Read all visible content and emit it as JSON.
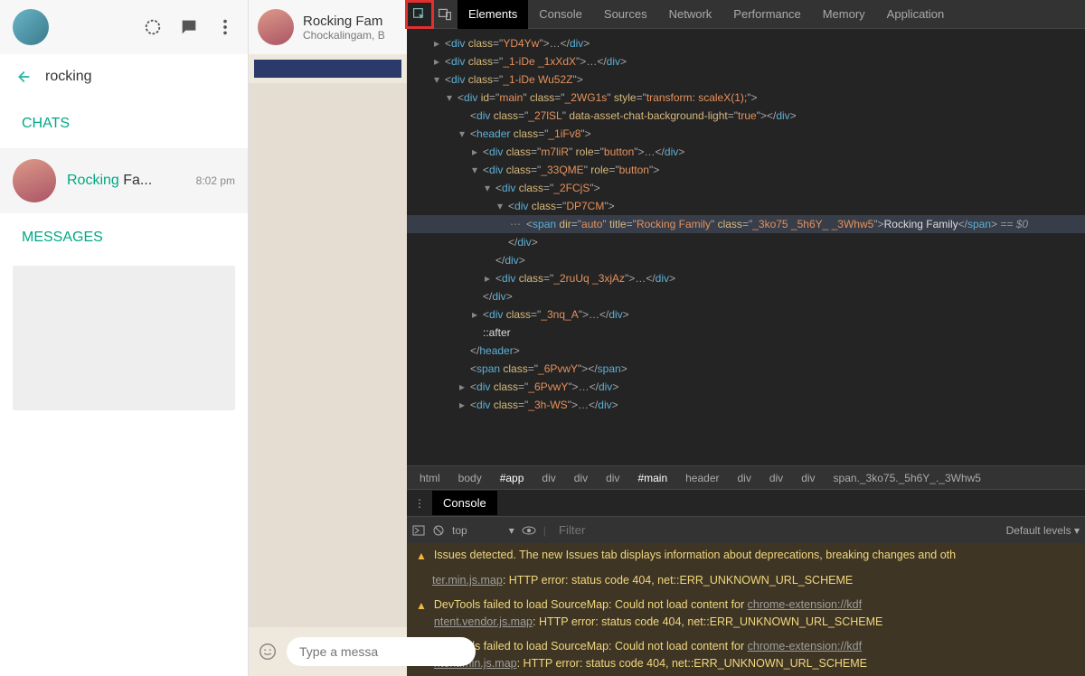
{
  "sidebar": {
    "search_value": "rocking",
    "section_chats": "CHATS",
    "section_messages": "MESSAGES",
    "chat": {
      "title_hl": "Rocking",
      "title_rest": " Fa...",
      "time": "8:02 pm"
    }
  },
  "chat": {
    "name": "Rocking Fam",
    "sub": "Chockalingam, B",
    "input_placeholder": "Type a messa"
  },
  "devtools": {
    "tabs": [
      "Elements",
      "Console",
      "Sources",
      "Network",
      "Performance",
      "Memory",
      "Application"
    ],
    "active_tab": "Elements",
    "crumbs": [
      "html",
      "body",
      "#app",
      "div",
      "div",
      "div",
      "#main",
      "header",
      "div",
      "div",
      "div",
      "span._3ko75._5h6Y_._3Whw5"
    ],
    "console_label": "Console",
    "scope": "top",
    "filter_placeholder": "Filter",
    "levels": "Default levels ▾",
    "issues_msg": "Issues detected. The new Issues tab displays information about deprecations, breaking changes and oth",
    "warn1_a": "ter.min.js.map",
    "warn1_b": ": HTTP error: status code 404, net::ERR_UNKNOWN_URL_SCHEME",
    "warn2_a": "DevTools failed to load SourceMap: Could not load content for ",
    "warn2_link": "chrome-extension://kdf",
    "warn2_b": "ntent.vendor.js.map",
    "warn2_c": ": HTTP error: status code 404, net::ERR_UNKNOWN_URL_SCHEME",
    "warn3_a": "DevTools failed to load SourceMap: Could not load content for ",
    "warn3_link": "chrome-extension://kdf",
    "warn3_b": "ntent.min.js.map",
    "warn3_c": ": HTTP error: status code 404, net::ERR_UNKNOWN_URL_SCHEME"
  },
  "dom": {
    "l1": {
      "cls": "YD4Yw"
    },
    "l2": {
      "cls": "_1-iDe _1xXdX"
    },
    "l3": {
      "cls": "_1-iDe Wu52Z"
    },
    "main": {
      "id": "main",
      "cls": "_2WG1s",
      "style": "transform: scaleX(1);"
    },
    "bg": {
      "cls": "_27lSL",
      "attr": "data-asset-chat-background-light",
      "av": "true"
    },
    "header": {
      "cls": "_1iFv8"
    },
    "btn1": {
      "cls": "m7liR",
      "role": "button"
    },
    "btn2": {
      "cls": "_33QME",
      "role": "button"
    },
    "fcjs": {
      "cls": "_2FCjS"
    },
    "dp7": {
      "cls": "DP7CM"
    },
    "span": {
      "dir": "auto",
      "title": "Rocking Family",
      "cls": "_3ko75 _5h6Y_ _3Whw5",
      "text": "Rocking Family",
      "eq": " == $0"
    },
    "ruuq": {
      "cls": "_2ruUq _3xjAz"
    },
    "nqa": {
      "cls": "_3nq_A"
    },
    "after": "::after",
    "sp6": {
      "cls": "_6PvwY"
    },
    "dv6": {
      "cls": "_6PvwY"
    },
    "dv3h": {
      "cls": "_3h-WS"
    }
  }
}
